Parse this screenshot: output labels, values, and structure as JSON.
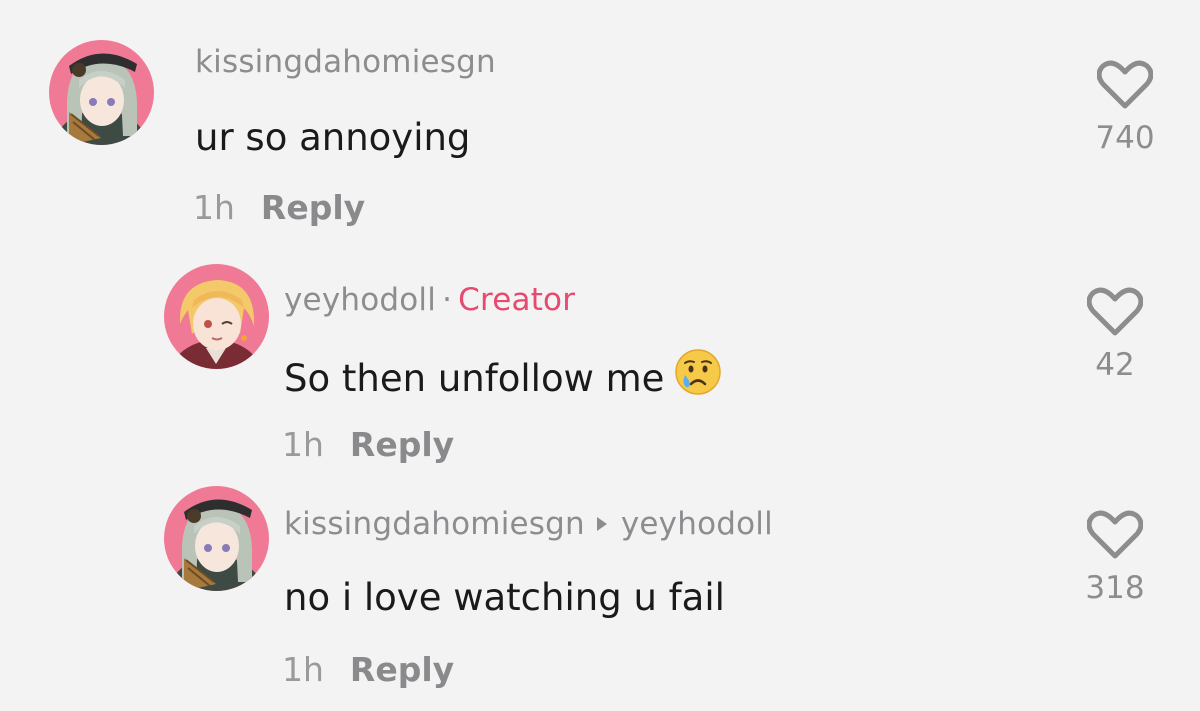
{
  "comments": [
    {
      "username": "kissingdahomiesgn",
      "text": "ur so annoying",
      "time": "1h",
      "reply_label": "Reply",
      "likes": "740"
    },
    {
      "username": "yeyhodoll",
      "separator": "·",
      "badge": "Creator",
      "text": "So then unfollow me",
      "emoji": "crying-face-emoji",
      "time": "1h",
      "reply_label": "Reply",
      "likes": "42"
    },
    {
      "username": "kissingdahomiesgn",
      "reply_to": "yeyhodoll",
      "text": "no i love watching u fail",
      "time": "1h",
      "reply_label": "Reply",
      "likes": "318"
    }
  ],
  "icons": {
    "like": "heart-outline-icon",
    "reply_arrow": "play-arrow-icon"
  },
  "colors": {
    "background": "#f4f3f4",
    "creator_badge": "#e64a6e",
    "secondary_text": "#8d8d90",
    "primary_text": "#1a1a1a",
    "avatar_bg": "#f07a95"
  }
}
